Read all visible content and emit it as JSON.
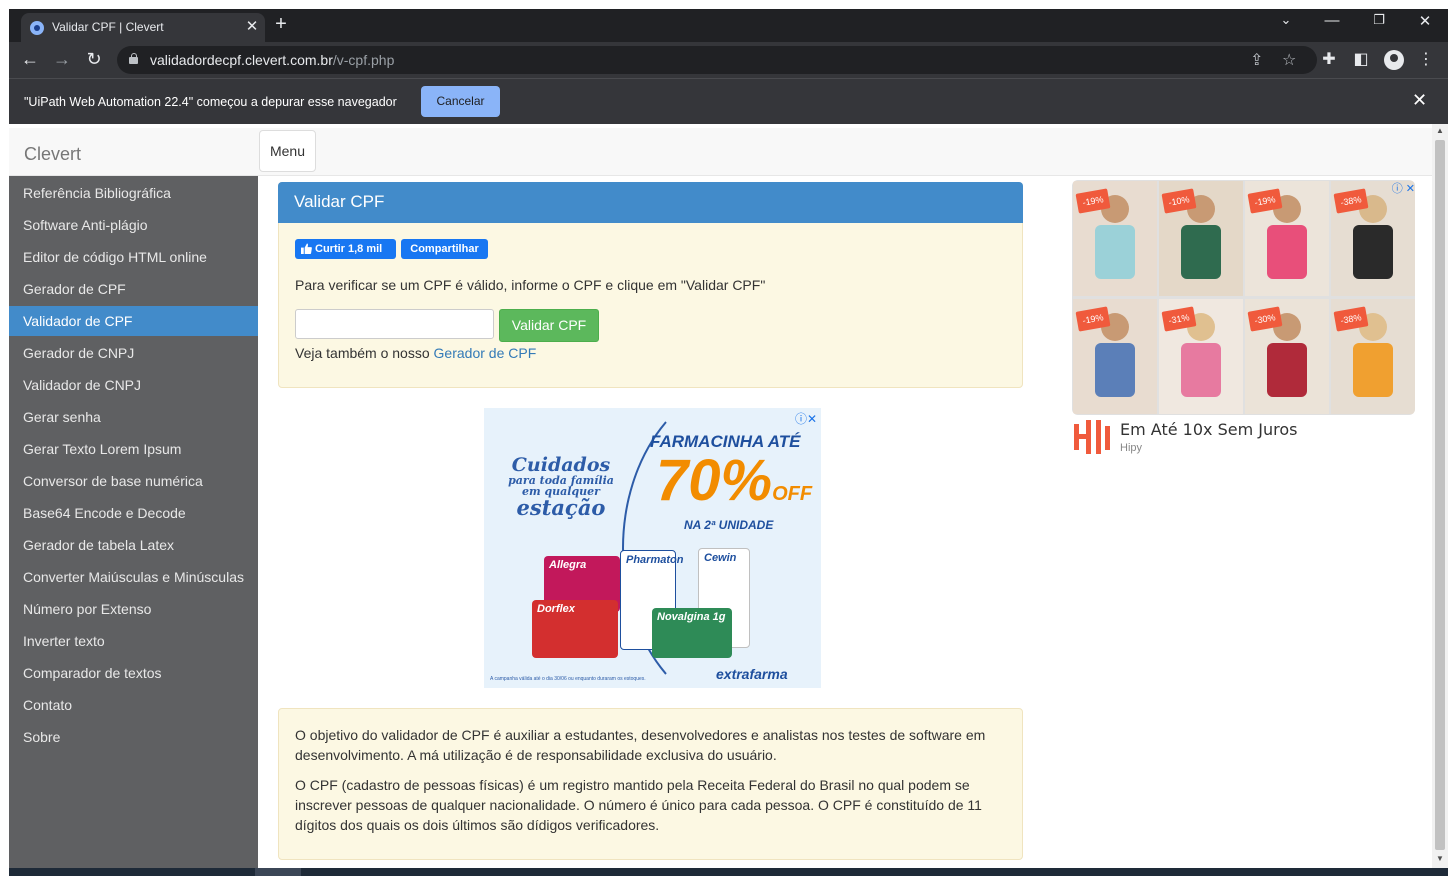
{
  "browser": {
    "tab_title": "Validar CPF | Clevert",
    "url_host": "validadordecpf.clevert.com.br",
    "url_path": "/v-cpf.php",
    "icons": [
      "back-icon",
      "forward-icon",
      "reload-icon",
      "lock-icon",
      "share-icon",
      "star-icon",
      "extensions-icon",
      "sidepanel-icon",
      "profile-icon",
      "menu-kebab-icon"
    ]
  },
  "infobar": {
    "message": "\"UiPath Web Automation 22.4\" começou a depurar esse navegador",
    "cancel_label": "Cancelar"
  },
  "navbar": {
    "brand": "Clevert",
    "menu_label": "Menu"
  },
  "sidebar": {
    "items": [
      {
        "label": "Referência Bibliográfica"
      },
      {
        "label": "Software Anti-plágio"
      },
      {
        "label": "Editor de código HTML online"
      },
      {
        "label": "Gerador de CPF"
      },
      {
        "label": "Validador de CPF",
        "active": true
      },
      {
        "label": "Gerador de CNPJ"
      },
      {
        "label": "Validador de CNPJ"
      },
      {
        "label": "Gerar senha"
      },
      {
        "label": "Gerar Texto Lorem Ipsum"
      },
      {
        "label": "Conversor de base numérica"
      },
      {
        "label": "Base64 Encode e Decode"
      },
      {
        "label": "Gerador de tabela Latex"
      },
      {
        "label": "Converter Maiúsculas e Minúsculas"
      },
      {
        "label": "Número por Extenso"
      },
      {
        "label": "Inverter texto"
      },
      {
        "label": "Comparador de textos"
      },
      {
        "label": "Contato"
      },
      {
        "label": "Sobre"
      }
    ]
  },
  "panel": {
    "title": "Validar CPF",
    "fb_like_label": "Curtir 1,8 mil",
    "fb_share_label": "Compartilhar",
    "instructions": "Para verificar se um CPF é válido, informe o CPF e clique em \"Validar CPF\"",
    "input_value": "",
    "validate_label": "Validar CPF",
    "see_also_prefix": "Veja também o nosso ",
    "see_also_link": "Gerador de CPF"
  },
  "ad_center": {
    "headline_1": "Cuidados",
    "headline_2": "para toda família",
    "headline_3": "em qualquer",
    "headline_4": "estação",
    "promo_1": "FARMACINHA ATÉ",
    "promo_2": "70%",
    "promo_3": "OFF",
    "promo_4": "NA 2ª UNIDADE",
    "products": [
      "Allegra",
      "Pharmaton",
      "Cewin",
      "Dorflex",
      "Novalgina 1g"
    ],
    "brand": "extrafarma",
    "footer": "A campanha válida até o dia 30/06 ou enquanto duraram os estoques."
  },
  "info": {
    "paragraph_1": "O objetivo do validador de CPF é auxiliar a estudantes, desenvolvedores e analistas nos testes de software em desenvolvimento. A má utilização é de responsabilidade exclusiva do usuário.",
    "paragraph_2": "O CPF (cadastro de pessoas físicas) é um registro mantido pela Receita Federal do Brasil no qual podem se inscrever pessoas de qualquer nacionalidade. O número é único para cada pessoa. O CPF é constituído de 11 dígitos dos quais os dois últimos são dídigos verificadores."
  },
  "ad_right": {
    "discounts": [
      "-19%",
      "-10%",
      "-19%",
      "-38%",
      "-19%",
      "-31%",
      "-30%",
      "-38%"
    ],
    "title": "Em Até 10x Sem Juros",
    "advertiser": "Hipy"
  }
}
